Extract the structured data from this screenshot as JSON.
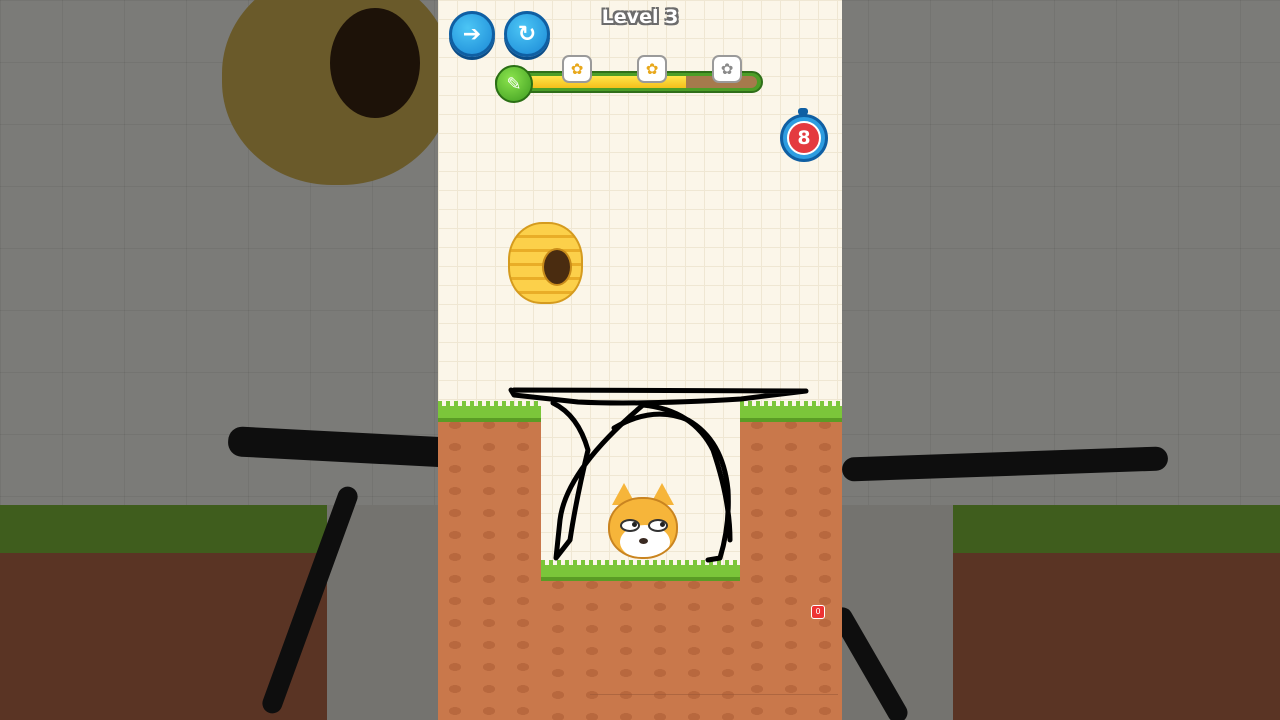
{
  "game": {
    "level_title": "Level 3",
    "buttons": {
      "back": "back-arrow-icon",
      "restart": "restart-icon"
    },
    "ink_meter": {
      "remaining_fraction": 0.7,
      "star_markers": [
        "paw-gold",
        "paw-gold",
        "paw-gray"
      ]
    },
    "timer": {
      "seconds_left": "8"
    },
    "record_badge": "0"
  },
  "colors": {
    "paper": "#fbf6e9",
    "grass": "#7bc63a",
    "dirt": "#c9784b",
    "button_blue": "#1a88d6",
    "timer_red": "#e43a3f",
    "ink_yellow": "#f5bf1b"
  }
}
